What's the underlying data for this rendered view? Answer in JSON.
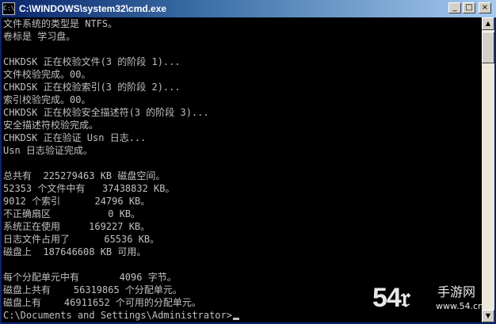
{
  "window": {
    "title": "C:\\WINDOWS\\system32\\cmd.exe",
    "icon_label": "C:\\",
    "buttons": {
      "minimize": "_",
      "maximize": "□",
      "close": "×"
    }
  },
  "console": {
    "lines": [
      "文件系统的类型是 NTFS。",
      "卷标是 学习盘。",
      "",
      "CHKDSK 正在校验文件(3 的阶段 1)...",
      "文件校验完成。00。",
      "CHKDSK 正在校验索引(3 的阶段 2)...",
      "索引校验完成。00。",
      "CHKDSK 正在校验安全描述符(3 的阶段 3)...",
      "安全描述符校验完成。",
      "CHKDSK 正在验证 Usn 日志...",
      "Usn 日志验证完成。",
      "",
      "总共有  225279463 KB 磁盘空间。",
      "52353 个文件中有   37438832 KB。",
      "9012 个索引      24796 KB。",
      "不正确扇区          0 KB。",
      "系统正在使用     169227 KB。",
      "日志文件占用了      65536 KB。",
      "磁盘上  187646608 KB 可用。",
      "",
      "每个分配单元中有       4096 字节。",
      "磁盘上共有    56319865 个分配单元。",
      "磁盘上有    46911652 个可用的分配单元。",
      "",
      "C:\\Documents and Settings\\Administrator>"
    ]
  },
  "scrollbar": {
    "up": "▲",
    "down": "▼"
  },
  "watermark": {
    "number": "54𝔯",
    "text": "手游网",
    "url": "www.54.cn"
  },
  "colors": {
    "console_bg": "#000000",
    "console_fg": "#c0c0c0",
    "titlebar": "#0a246a"
  }
}
